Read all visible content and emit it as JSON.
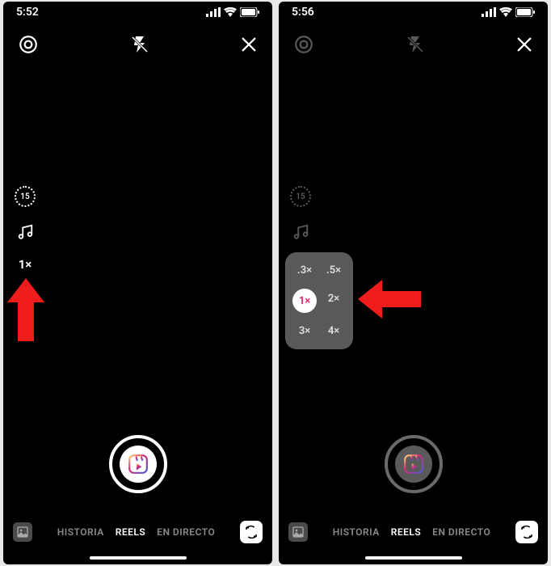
{
  "left": {
    "time": "5:52",
    "timer_value": "15",
    "speed_label": "1×",
    "tabs": {
      "historia": "HISTORIA",
      "reels": "REELS",
      "directo": "EN DIRECTO"
    }
  },
  "right": {
    "time": "5:56",
    "timer_value": "15",
    "tabs": {
      "historia": "HISTORIA",
      "reels": "REELS",
      "directo": "EN DIRECTO"
    },
    "speed_options": {
      "o03": ".3×",
      "o05": ".5×",
      "o1": "1×",
      "o2": "2×",
      "o3": "3×",
      "o4": "4×"
    }
  }
}
